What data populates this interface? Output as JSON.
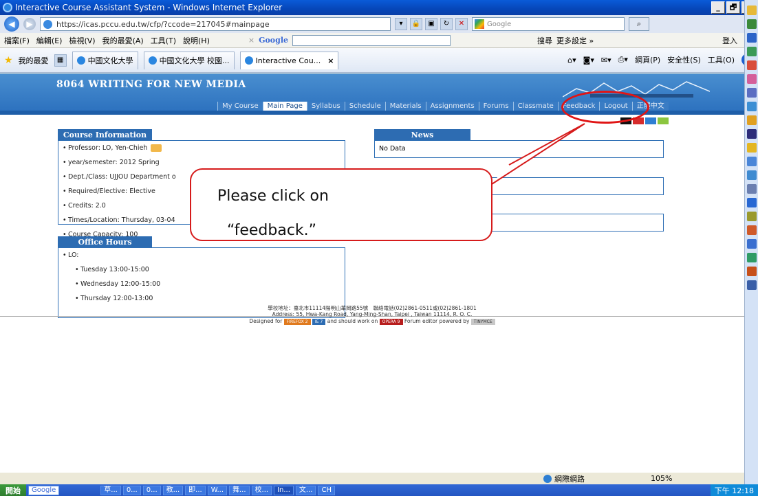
{
  "window": {
    "title": "Interactive Course Assistant System - Windows Internet Explorer",
    "btn_min": "_",
    "btn_max": "🗗",
    "btn_close": "✕"
  },
  "address": {
    "url": "https://icas.pccu.edu.tw/cfp/?ccode=217045#mainpage",
    "search_placeholder": "Google"
  },
  "menu": {
    "items": [
      "檔案(F)",
      "編輯(E)",
      "檢視(V)",
      "我的最愛(A)",
      "工具(T)",
      "說明(H)"
    ],
    "gclose": "×",
    "google_label": "Google",
    "search_btn": "搜尋",
    "more_settings": "更多設定 »",
    "login": "登入"
  },
  "favorites": {
    "label": "我的最愛",
    "tabs": [
      "中國文化大學",
      "中國文化大學 校園...",
      "Interactive Cou..."
    ],
    "tab_close": "×"
  },
  "command_bar": {
    "page": "網頁(P)",
    "safety": "安全性(S)",
    "tools": "工具(O)",
    "help": "?"
  },
  "page": {
    "course_title": "8064 WRITING FOR NEW MEDIA",
    "nav": [
      "My Course",
      "Main Page",
      "Syllabus",
      "Schedule",
      "Materials",
      "Assignments",
      "Forums",
      "Classmate",
      "Feedback",
      "Logout",
      "正體中文"
    ],
    "active_nav": "Main Page",
    "swatch_colors": [
      "#111111",
      "#d62b2b",
      "#2e7fd3",
      "#8cc63f"
    ]
  },
  "course_info": {
    "heading": "Course Information",
    "items": [
      "Professor: LO, Yen-Chieh",
      "year/semester: 2012 Spring",
      "Dept./Class: UJJOU Department o",
      "Required/Elective: Elective",
      "Credits: 2.0",
      "Times/Location: Thursday, 03-04",
      "Course Capacity: 100"
    ]
  },
  "office_hours": {
    "heading": "Office Hours",
    "person": "LO:",
    "slots": [
      "Tuesday 13:00-15:00",
      "Wednesday 12:00-15:00",
      "Thursday 12:00-13:00"
    ]
  },
  "news": {
    "heading": "News",
    "text": "No Data"
  },
  "callout": {
    "line1": "Please click on",
    "line2": "“feedback.”"
  },
  "footer": {
    "line1": "學校地址：臺北市11114陽明山華岡路55號　聯絡電話(02)2861-0511或(02)2861-1801",
    "line2": "Address: 55, Hwa-Kang Road, Yang-Ming-Shan, Taipei , Taiwan 11114, R. O. C.",
    "designed_for": "Designed for",
    "ff": "FIREFOX 2",
    "ie": "IE 7",
    "should_work": "and should work on",
    "opera": "OPERA 9",
    "editor": "Forum editor powered by",
    "tinymce": "TINYMCE"
  },
  "status": {
    "zone": "網際網路",
    "zoom": "105%"
  },
  "taskbar": {
    "start": "開始",
    "google": "Google",
    "tasks": [
      "草...",
      "0...",
      "0...",
      "教...",
      "即...",
      "W...",
      "舞...",
      "校...",
      "In...",
      "文..."
    ],
    "lang": "CH",
    "clock": "下午 12:18"
  }
}
